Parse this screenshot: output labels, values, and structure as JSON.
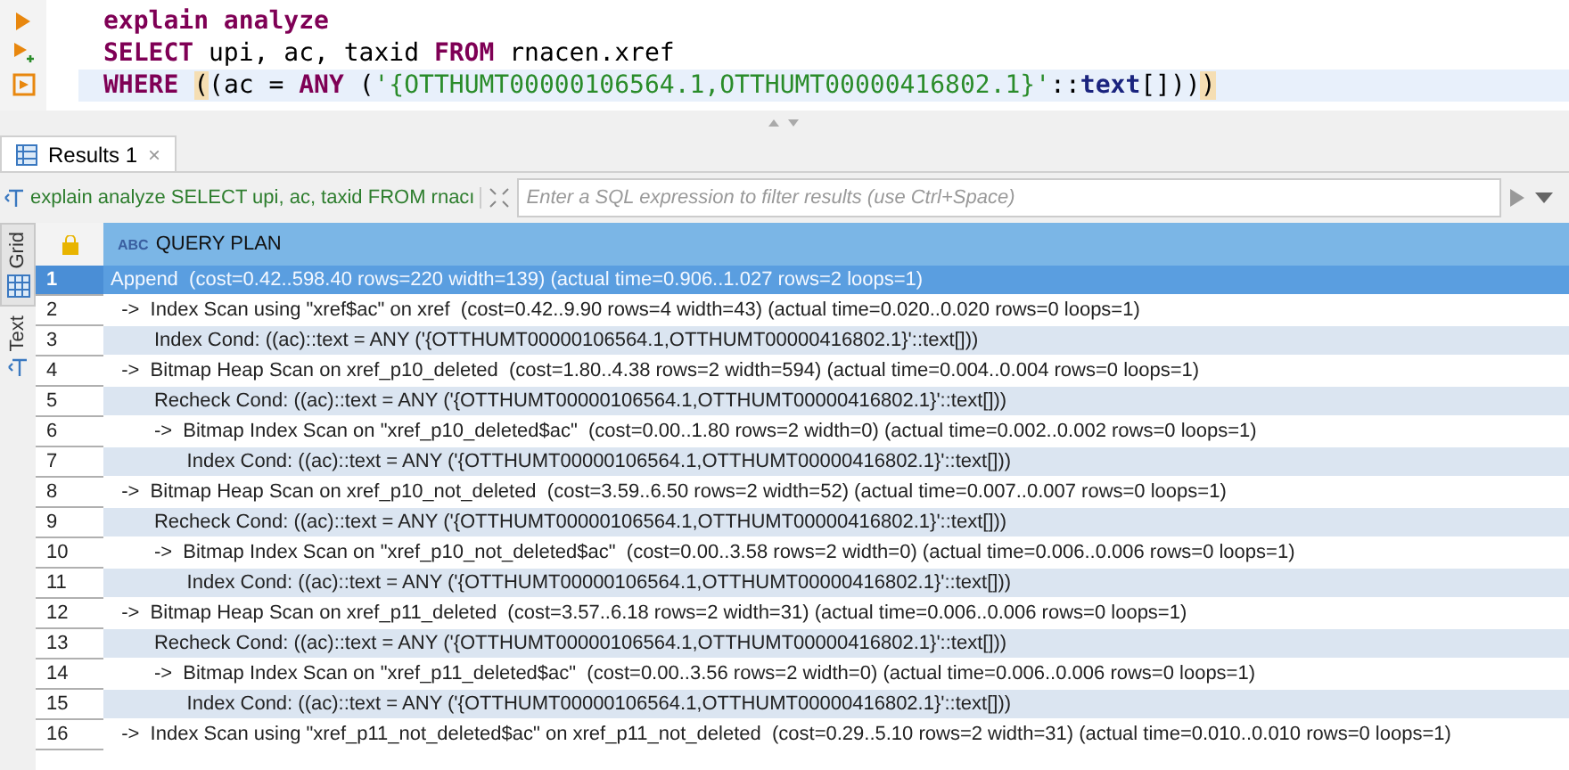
{
  "editor": {
    "lines": [
      [
        {
          "text": "explain analyze",
          "kind": "keyword"
        }
      ],
      [
        {
          "text": "SELECT",
          "kind": "keyword"
        },
        {
          "text": " upi, ac, taxid ",
          "kind": "plain"
        },
        {
          "text": "FROM",
          "kind": "keyword"
        },
        {
          "text": " rnacen.xref",
          "kind": "plain"
        }
      ],
      [
        {
          "text": "WHERE ",
          "kind": "keyword"
        },
        {
          "text": "(",
          "kind": "match"
        },
        {
          "text": "(ac = ",
          "kind": "plain"
        },
        {
          "text": "ANY",
          "kind": "keyword"
        },
        {
          "text": " (",
          "kind": "plain"
        },
        {
          "text": "'{OTTHUMT00000106564.1,OTTHUMT00000416802.1}'",
          "kind": "string"
        },
        {
          "text": "::",
          "kind": "plain"
        },
        {
          "text": "text",
          "kind": "type"
        },
        {
          "text": "[]))",
          "kind": "plain"
        },
        {
          "text": ")",
          "kind": "match"
        }
      ]
    ]
  },
  "results_tab": {
    "label": "Results 1",
    "close": "×"
  },
  "filter": {
    "query": "explain analyze SELECT upi, ac, taxid FROM rnacı",
    "placeholder": "Enter a SQL expression to filter results (use Ctrl+Space)"
  },
  "side_tabs": [
    {
      "label": "Grid",
      "selected": true
    },
    {
      "label": "Text",
      "selected": false
    }
  ],
  "table": {
    "column": "QUERY PLAN",
    "column_type": "ABC",
    "rows": [
      {
        "n": "1",
        "text": "Append  (cost=0.42..598.40 rows=220 width=139) (actual time=0.906..1.027 rows=2 loops=1)",
        "selected": true
      },
      {
        "n": "2",
        "text": "  ->  Index Scan using \"xref$ac\" on xref  (cost=0.42..9.90 rows=4 width=43) (actual time=0.020..0.020 rows=0 loops=1)",
        "selected": false
      },
      {
        "n": "3",
        "text": "        Index Cond: ((ac)::text = ANY ('{OTTHUMT00000106564.1,OTTHUMT00000416802.1}'::text[]))",
        "selected": false
      },
      {
        "n": "4",
        "text": "  ->  Bitmap Heap Scan on xref_p10_deleted  (cost=1.80..4.38 rows=2 width=594) (actual time=0.004..0.004 rows=0 loops=1)",
        "selected": false
      },
      {
        "n": "5",
        "text": "        Recheck Cond: ((ac)::text = ANY ('{OTTHUMT00000106564.1,OTTHUMT00000416802.1}'::text[]))",
        "selected": false
      },
      {
        "n": "6",
        "text": "        ->  Bitmap Index Scan on \"xref_p10_deleted$ac\"  (cost=0.00..1.80 rows=2 width=0) (actual time=0.002..0.002 rows=0 loops=1)",
        "selected": false
      },
      {
        "n": "7",
        "text": "              Index Cond: ((ac)::text = ANY ('{OTTHUMT00000106564.1,OTTHUMT00000416802.1}'::text[]))",
        "selected": false
      },
      {
        "n": "8",
        "text": "  ->  Bitmap Heap Scan on xref_p10_not_deleted  (cost=3.59..6.50 rows=2 width=52) (actual time=0.007..0.007 rows=0 loops=1)",
        "selected": false
      },
      {
        "n": "9",
        "text": "        Recheck Cond: ((ac)::text = ANY ('{OTTHUMT00000106564.1,OTTHUMT00000416802.1}'::text[]))",
        "selected": false
      },
      {
        "n": "10",
        "text": "        ->  Bitmap Index Scan on \"xref_p10_not_deleted$ac\"  (cost=0.00..3.58 rows=2 width=0) (actual time=0.006..0.006 rows=0 loops=1)",
        "selected": false
      },
      {
        "n": "11",
        "text": "              Index Cond: ((ac)::text = ANY ('{OTTHUMT00000106564.1,OTTHUMT00000416802.1}'::text[]))",
        "selected": false
      },
      {
        "n": "12",
        "text": "  ->  Bitmap Heap Scan on xref_p11_deleted  (cost=3.57..6.18 rows=2 width=31) (actual time=0.006..0.006 rows=0 loops=1)",
        "selected": false
      },
      {
        "n": "13",
        "text": "        Recheck Cond: ((ac)::text = ANY ('{OTTHUMT00000106564.1,OTTHUMT00000416802.1}'::text[]))",
        "selected": false
      },
      {
        "n": "14",
        "text": "        ->  Bitmap Index Scan on \"xref_p11_deleted$ac\"  (cost=0.00..3.56 rows=2 width=0) (actual time=0.006..0.006 rows=0 loops=1)",
        "selected": false
      },
      {
        "n": "15",
        "text": "              Index Cond: ((ac)::text = ANY ('{OTTHUMT00000106564.1,OTTHUMT00000416802.1}'::text[]))",
        "selected": false
      },
      {
        "n": "16",
        "text": "  ->  Index Scan using \"xref_p11_not_deleted$ac\" on xref_p11_not_deleted  (cost=0.29..5.10 rows=2 width=31) (actual time=0.010..0.010 rows=0 loops=1)",
        "selected": false
      }
    ]
  }
}
